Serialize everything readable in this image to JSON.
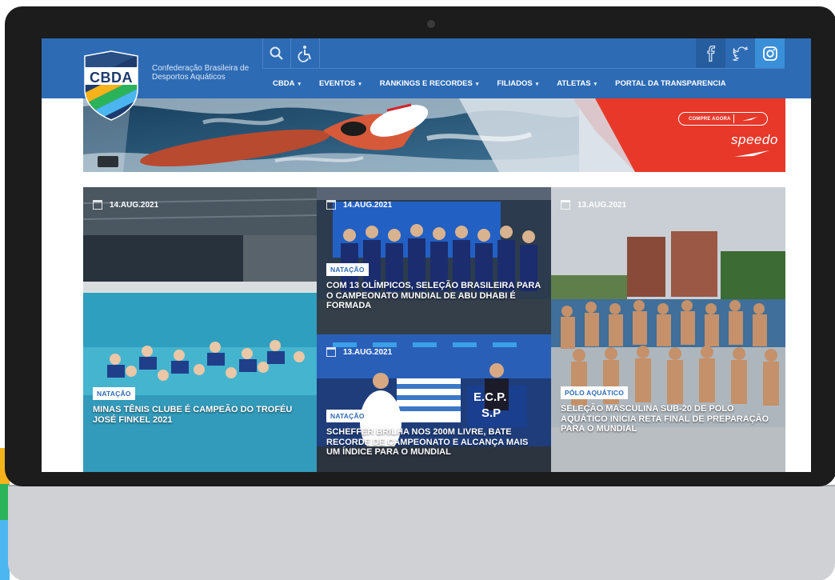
{
  "org": {
    "logo_text": "CBDA",
    "name_line1": "Confederação Brasileira de",
    "name_line2": "Desportos Aquáticos"
  },
  "header": {
    "icons": [
      "search-icon",
      "accessibility-icon"
    ],
    "social": [
      "facebook-icon",
      "twitter-icon",
      "instagram-icon"
    ],
    "nav": [
      {
        "label": "CBDA",
        "caret": "▾"
      },
      {
        "label": "EVENTOS",
        "caret": "▾"
      },
      {
        "label": "RANKINGS E RECORDES",
        "caret": "▾"
      },
      {
        "label": "FILIADOS",
        "caret": "▾"
      },
      {
        "label": "ATLETAS",
        "caret": "▾"
      },
      {
        "label": "PORTAL DA TRANSPARENCIA",
        "caret": ""
      }
    ]
  },
  "banner": {
    "cta": "COMPRE AGORA",
    "brand": "speedo"
  },
  "news": [
    {
      "date": "14.AUG.2021",
      "category": "NATAÇÃO",
      "title": "MINAS TÊNIS CLUBE É CAMPEÃO DO TROFÉU JOSÉ FINKEL 2021"
    },
    {
      "date": "14.AUG.2021",
      "category": "NATAÇÃO",
      "title": "COM 13 OLÍMPICOS, SELEÇÃO BRASILEIRA PARA O CAMPEONATO MUNDIAL DE ABU DHABI É FORMADA"
    },
    {
      "date": "13.AUG.2021",
      "category": "NATAÇÃO",
      "title": "SCHEFFER BRILHA NOS 200M LIVRE, BATE RECORDE DE CAMPEONATO E ALCANÇA MAIS UM ÍNDICE PARA O MUNDIAL",
      "flag_text1": "E.C.P.",
      "flag_text2": "S.P"
    },
    {
      "date": "13.AUG.2021",
      "category": "PÓLO AQUÁTICO",
      "title": "SELEÇÃO MASCULINA SUB-20 DE POLO AQUÁTICO INICIA RETA FINAL DE PREPARAÇÃO PARA O MUNDIAL"
    }
  ],
  "colors": {
    "brand_blue": "#2d6bb5",
    "speedo_red": "#e8382a",
    "bezel": "#1c1c1c"
  }
}
